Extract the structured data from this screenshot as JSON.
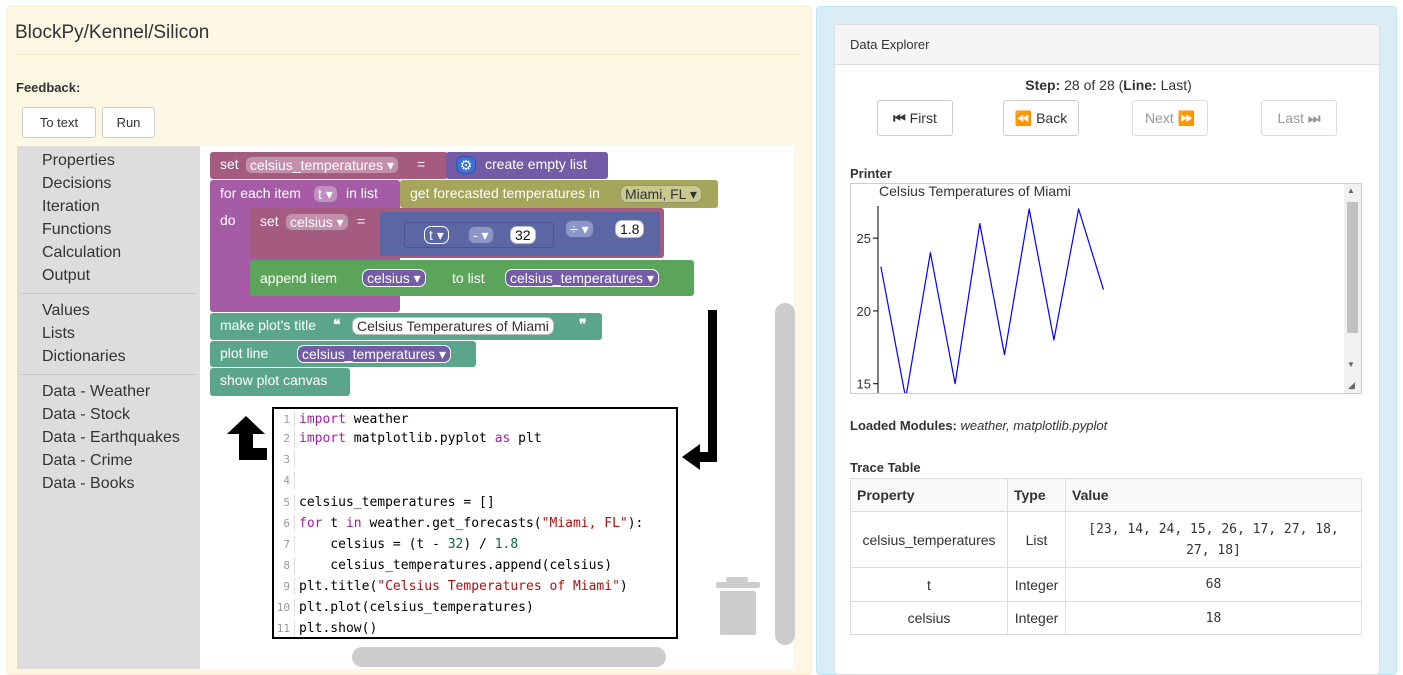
{
  "app": {
    "title": "BlockPy/Kennel/Silicon"
  },
  "feedback": {
    "label": "Feedback:"
  },
  "toolbar": {
    "to_text": "To text",
    "run": "Run"
  },
  "toolbox": {
    "group1": [
      "Properties",
      "Decisions",
      "Iteration",
      "Functions",
      "Calculation",
      "Output"
    ],
    "group2": [
      "Values",
      "Lists",
      "Dictionaries"
    ],
    "group3": [
      "Data - Weather",
      "Data - Stock",
      "Data - Earthquakes",
      "Data - Crime",
      "Data - Books"
    ]
  },
  "blocks": {
    "set1": {
      "kw": "set",
      "var": "celsius_temperatures",
      "eq": "=",
      "create": "create empty list"
    },
    "foreach": {
      "kw": "for each item",
      "var": "t",
      "inlist": "in list",
      "func": "get forecasted temperatures in",
      "city": "Miami, FL",
      "do": "do"
    },
    "set2": {
      "kw": "set",
      "var": "celsius",
      "eq": "=",
      "t": "t",
      "minus": "-",
      "n32": "32",
      "div": "÷",
      "n18": "1.8"
    },
    "append": {
      "kw": "append item",
      "var": "celsius",
      "tolist": "to list",
      "list": "celsius_temperatures"
    },
    "title": {
      "kw": "make plot's title",
      "open": "❝",
      "text": "Celsius Temperatures of Miami",
      "close": "❞"
    },
    "plotline": {
      "kw": "plot line",
      "var": "celsius_temperatures"
    },
    "show": {
      "kw": "show plot canvas"
    }
  },
  "code": {
    "numbers": [
      "1",
      "2",
      "3",
      "4",
      "5",
      "6",
      "7",
      "8",
      "9",
      "10",
      "11"
    ],
    "lines": [
      {
        "a": "",
        "k1": "import",
        "b": " weather",
        "s": "",
        "c": ""
      },
      {
        "a": "",
        "k1": "import",
        "b": " matplotlib.pyplot ",
        "k2": "as",
        "c": " plt"
      },
      {
        "a": "",
        "k1": "",
        "b": "",
        "s": "",
        "c": ""
      },
      {
        "a": "",
        "k1": "",
        "b": "",
        "s": "",
        "c": ""
      },
      {
        "a": "celsius_temperatures = []",
        "k1": "",
        "b": "",
        "s": "",
        "c": ""
      },
      {
        "a": "",
        "k1": "for",
        "b": " t ",
        "k2": "in",
        "c": " weather.get_forecasts(",
        "s": "\"Miami, FL\"",
        "d": "):"
      },
      {
        "a": "    celsius = (t - ",
        "n1": "32",
        "b": ") / ",
        "n2": "1.8"
      },
      {
        "a": "    celsius_temperatures.append(celsius)"
      },
      {
        "a": "plt.title(",
        "s": "\"Celsius Temperatures of Miami\"",
        "c": ")"
      },
      {
        "a": "plt.plot(celsius_temperatures)"
      },
      {
        "a": "plt.show()"
      }
    ]
  },
  "explorer": {
    "header": "Data Explorer",
    "step_label": "Step:",
    "step_text": "28 of 28 (",
    "line_label": "Line:",
    "line_text": "Last)",
    "buttons": {
      "first": "First",
      "back": "Back",
      "next": "Next",
      "last": "Last"
    },
    "printer_label": "Printer",
    "loaded_label": "Loaded Modules:",
    "loaded_value": "weather, matplotlib.pyplot",
    "trace_label": "Trace Table",
    "trace_headers": [
      "Property",
      "Type",
      "Value"
    ],
    "trace_rows": [
      {
        "property": "celsius_temperatures",
        "type": "List",
        "value": "[23, 14, 24, 15, 26, 17, 27, 18, 27, 18]"
      },
      {
        "property": "t",
        "type": "Integer",
        "value": "68"
      },
      {
        "property": "celsius",
        "type": "Integer",
        "value": "18"
      }
    ]
  },
  "chart_data": {
    "type": "line",
    "title": "Celsius Temperatures of Miami",
    "x": [
      0,
      1,
      2,
      3,
      4,
      5,
      6,
      7,
      8,
      9
    ],
    "series": [
      {
        "values": [
          23,
          14,
          24,
          15,
          26,
          17,
          27,
          18,
          27,
          21.5
        ]
      }
    ],
    "yticks": [
      "15",
      "20",
      "25"
    ],
    "ylim": [
      14.5,
      27
    ],
    "grid": false,
    "color": "#0000ff"
  },
  "colors": {
    "var_block": "#a55b80",
    "loop": "#a55ba5",
    "list": "#745ba5",
    "plot": "#5ba58c",
    "data": "#a5a55b"
  }
}
